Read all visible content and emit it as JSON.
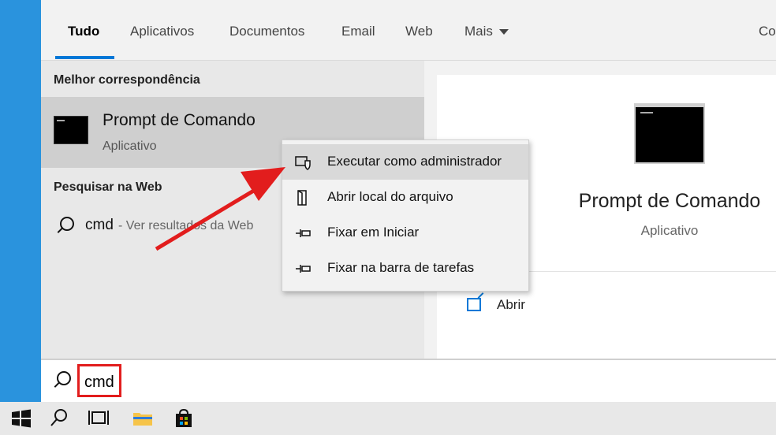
{
  "tabs": [
    {
      "label": "Tudo",
      "active": true
    },
    {
      "label": "Aplicativos"
    },
    {
      "label": "Documentos"
    },
    {
      "label": "Email"
    },
    {
      "label": "Web"
    },
    {
      "label": "Mais"
    }
  ],
  "tabs_overflow_label": "Co",
  "best_match": {
    "section_title": "Melhor correspondência",
    "title": "Prompt de Comando",
    "subtitle": "Aplicativo"
  },
  "web_search": {
    "section_title": "Pesquisar na Web",
    "query": "cmd",
    "hint": "- Ver resultados da Web"
  },
  "preview": {
    "title": "Prompt de Comando",
    "subtitle": "Aplicativo",
    "open_label": "Abrir"
  },
  "context_menu": {
    "items": [
      {
        "label": "Executar como administrador",
        "icon": "admin-shield-icon"
      },
      {
        "label": "Abrir local do arquivo",
        "icon": "file-location-icon"
      },
      {
        "label": "Fixar em Iniciar",
        "icon": "pin-icon"
      },
      {
        "label": "Fixar na barra de tarefas",
        "icon": "pin-icon"
      }
    ]
  },
  "search_bar": {
    "value": "cmd"
  },
  "colors": {
    "accent": "#0078d7",
    "highlight_red": "#e21d1d"
  }
}
